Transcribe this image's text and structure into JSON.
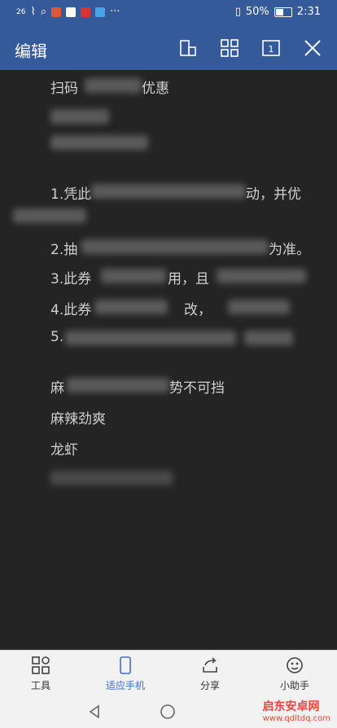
{
  "status": {
    "signal": "26",
    "battery": "50%",
    "time": "2:31"
  },
  "header": {
    "title": "编辑"
  },
  "doc_lines": [
    "扫码",
    "优惠",
    "1.凭此",
    "动，并优",
    "2.抽",
    "为准。",
    "3.此券",
    "用，且",
    "4.此券",
    "改，",
    "5.",
    "麻",
    "势不可挡",
    "麻辣劲爽",
    "龙虾"
  ],
  "toolbar": {
    "tools": [
      {
        "label": "工具"
      },
      {
        "label": "适应手机"
      },
      {
        "label": "分享"
      },
      {
        "label": "小助手"
      }
    ]
  },
  "watermark": {
    "brand": "启东安卓网",
    "url": "www.qdltdq.com"
  }
}
